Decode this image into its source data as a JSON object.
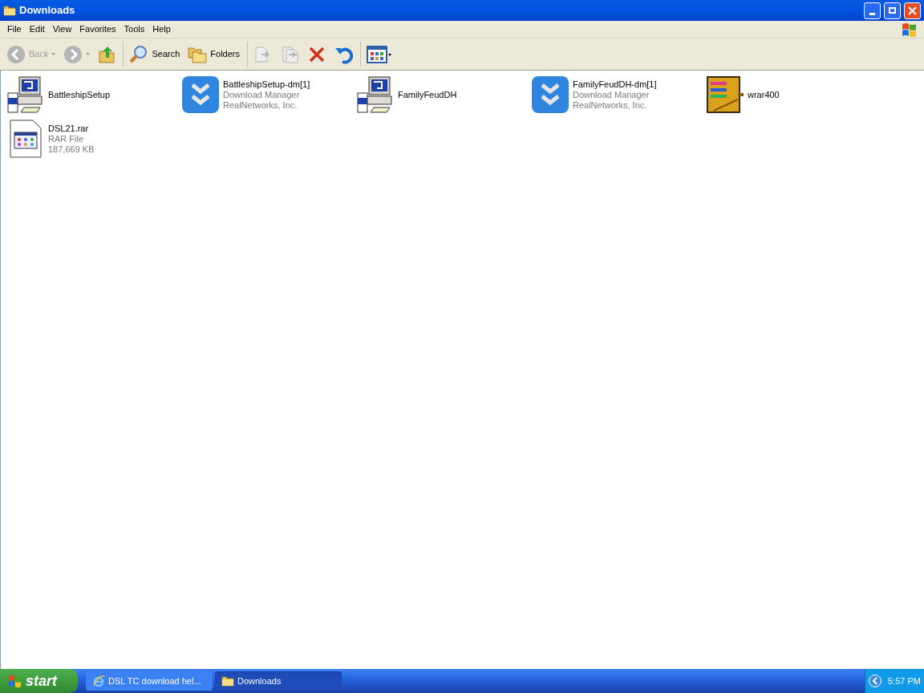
{
  "window": {
    "title": "Downloads"
  },
  "menu": [
    "File",
    "Edit",
    "View",
    "Favorites",
    "Tools",
    "Help"
  ],
  "toolbar": [
    {
      "kind": "back",
      "label": "Back",
      "disabled": true
    },
    {
      "kind": "forward",
      "disabled": true
    },
    {
      "kind": "up",
      "disabled": false
    },
    {
      "kind": "search",
      "label": "Search",
      "disabled": false
    },
    {
      "kind": "folders",
      "label": "Folders",
      "disabled": false
    },
    {
      "kind": "move",
      "disabled": true
    },
    {
      "kind": "copy",
      "disabled": true
    },
    {
      "kind": "delete",
      "disabled": false
    },
    {
      "kind": "undo",
      "disabled": false
    },
    {
      "kind": "views",
      "disabled": false
    }
  ],
  "files": [
    {
      "kind": "installer",
      "name": "BattleshipSetup"
    },
    {
      "kind": "download_manager",
      "name": "BattleshipSetup-dm[1]",
      "details": [
        "Download Manager",
        "RealNetworks, Inc."
      ]
    },
    {
      "kind": "installer",
      "name": "FamilyFeudDH"
    },
    {
      "kind": "download_manager",
      "name": "FamilyFeudDH-dm[1]",
      "details": [
        "Download Manager",
        "RealNetworks, Inc."
      ]
    },
    {
      "kind": "archive",
      "name": "wrar400"
    },
    {
      "kind": "rar_file",
      "name": "DSL21.rar",
      "details": [
        "RAR File",
        "187,669 KB"
      ]
    }
  ],
  "taskbar": {
    "start": "start",
    "tasks": [
      {
        "kind": "browser",
        "label": "DSL TC download hel...",
        "selected": false
      },
      {
        "kind": "folder",
        "label": "Downloads",
        "selected": true
      }
    ],
    "clock": "5:57 PM"
  }
}
